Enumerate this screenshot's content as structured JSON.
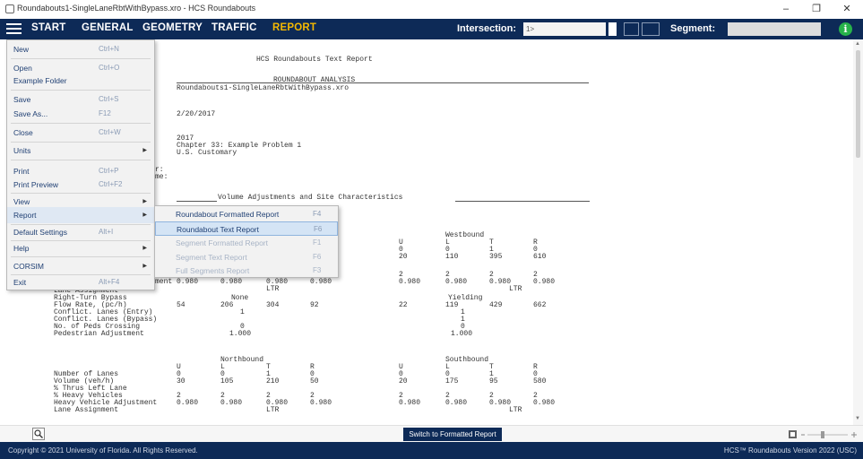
{
  "window": {
    "title": "Roundabouts1-SingleLaneRbtWithBypass.xro - HCS Roundabouts",
    "minimize": "–",
    "maximize": "❐",
    "close": "✕"
  },
  "menubar": {
    "tabs": [
      "START",
      "GENERAL",
      "GEOMETRY",
      "TRAFFIC",
      "REPORT"
    ],
    "active_tab": "REPORT",
    "intersection_label": "Intersection:",
    "intersection_value": "1>",
    "segment_label": "Segment:",
    "info_icon": "i",
    "accent_color": "#f5b800",
    "bar_color": "#0d2a57"
  },
  "file_menu": {
    "items": [
      {
        "label": "New",
        "shortcut": "Ctrl+N"
      },
      {
        "label": "Open",
        "shortcut": "Ctrl+O"
      },
      {
        "label": "Example Folder",
        "shortcut": ""
      },
      {
        "label": "Save",
        "shortcut": "Ctrl+S"
      },
      {
        "label": "Save As...",
        "shortcut": "F12"
      },
      {
        "label": "Close",
        "shortcut": "Ctrl+W"
      },
      {
        "label": "Units",
        "shortcut": "",
        "submenu": true
      },
      {
        "label": "Print",
        "shortcut": "Ctrl+P"
      },
      {
        "label": "Print Preview",
        "shortcut": "Ctrl+F2"
      },
      {
        "label": "View",
        "shortcut": "",
        "submenu": true
      },
      {
        "label": "Report",
        "shortcut": "",
        "submenu": true
      },
      {
        "label": "Default Settings",
        "shortcut": "Alt+I"
      },
      {
        "label": "Help",
        "shortcut": "",
        "submenu": true
      },
      {
        "label": "CORSIM",
        "shortcut": "",
        "submenu": true
      },
      {
        "label": "Exit",
        "shortcut": "Alt+F4"
      }
    ],
    "active_item": "Report"
  },
  "report_submenu": {
    "items": [
      {
        "label": "Roundabout Formatted Report",
        "shortcut": "F4",
        "enabled": true
      },
      {
        "label": "Roundabout Text Report",
        "shortcut": "F6",
        "enabled": true,
        "selected": true
      },
      {
        "label": "Segment Formatted Report",
        "shortcut": "F1",
        "enabled": false
      },
      {
        "label": "Segment Text Report",
        "shortcut": "F6",
        "enabled": false
      },
      {
        "label": "Full Segments Report",
        "shortcut": "F3",
        "enabled": false
      }
    ]
  },
  "report": {
    "title": "HCS Roundabouts Text Report",
    "analysis_header": "ROUNDABOUT ANALYSIS",
    "file_name": "Roundabouts1-SingleLaneRbtWithBypass.xro",
    "date": "2/20/2017",
    "analysis_year": "2017",
    "description": "Chapter 33: Example Problem 1",
    "units": "U.S. Customary",
    "partial_label_1": "r:",
    "partial_label_2": "me:",
    "section_header": "Volume Adjustments and Site Characteristics",
    "partial_label_3": "ment",
    "westbound": {
      "header": "Westbound",
      "movements": [
        "U",
        "L",
        "T",
        "R"
      ],
      "number_of_lanes": [
        "0",
        "0",
        "1",
        "0"
      ],
      "volume": [
        "20",
        "110",
        "395",
        "610"
      ],
      "heavy_vehicles": [
        "2",
        "2",
        "2",
        "2"
      ],
      "heavy_vehicle_adjustment": [
        "0.980",
        "0.980",
        "0.980",
        "0.980"
      ],
      "lane_assignment": "LTR",
      "right_turn_bypass": "Yielding",
      "flow_rate": [
        "22",
        "119",
        "429",
        "662"
      ],
      "conflict_lanes_entry": "1",
      "conflict_lanes_bypass": "1",
      "peds_crossing": "0",
      "pedestrian_adjustment": "1.000"
    },
    "eastbound_partial": {
      "heavy_vehicle_adjustment": [
        "0.980",
        "0.980",
        "0.980",
        "0.980"
      ],
      "lane_assignment": "LTR",
      "right_turn_bypass": "None",
      "flow_rate": [
        "54",
        "206",
        "304",
        "92"
      ],
      "conflict_lanes_entry": "1",
      "peds_crossing": "0",
      "pedestrian_adjustment": "1.000"
    },
    "row_labels": {
      "lane_assignment": "Lane Assignment",
      "right_turn_bypass": "Right-Turn Bypass",
      "flow_rate": "Flow Rate, (pc/h)",
      "conflict_entry": "Conflict. Lanes (Entry)",
      "conflict_bypass": "Conflict. Lanes (Bypass)",
      "peds_crossing": "No. of Peds Crossing",
      "pedestrian_adjustment": "Pedestrian Adjustment",
      "number_of_lanes": "Number of Lanes",
      "volume": "Volume (veh/h)",
      "thrus_left": "% Thrus Left Lane",
      "heavy_vehicles": "% Heavy Vehicles",
      "heavy_vehicle_adjustment": "Heavy Vehicle Adjustment"
    },
    "northbound": {
      "header": "Northbound",
      "movements": [
        "U",
        "L",
        "T",
        "R"
      ],
      "number_of_lanes": [
        "0",
        "0",
        "1",
        "0"
      ],
      "volume": [
        "30",
        "105",
        "210",
        "50"
      ],
      "heavy_vehicles": [
        "2",
        "2",
        "2",
        "2"
      ],
      "heavy_vehicle_adjustment": [
        "0.980",
        "0.980",
        "0.980",
        "0.980"
      ],
      "lane_assignment": "LTR"
    },
    "southbound": {
      "header": "Southbound",
      "movements": [
        "U",
        "L",
        "T",
        "R"
      ],
      "number_of_lanes": [
        "0",
        "0",
        "1",
        "0"
      ],
      "volume": [
        "20",
        "175",
        "95",
        "580"
      ],
      "heavy_vehicles": [
        "2",
        "2",
        "2",
        "2"
      ],
      "heavy_vehicle_adjustment": [
        "0.980",
        "0.980",
        "0.980",
        "0.980"
      ],
      "lane_assignment": "LTR"
    }
  },
  "bottom": {
    "switch_button": "Switch to Formatted Report",
    "search_icon": "search-icon",
    "zoom_minus": "−",
    "zoom_plus": "+"
  },
  "footer": {
    "copyright": "Copyright © 2021 University of Florida. All Rights Reserved.",
    "version": "HCS™ Roundabouts Version 2022 (USC)"
  }
}
